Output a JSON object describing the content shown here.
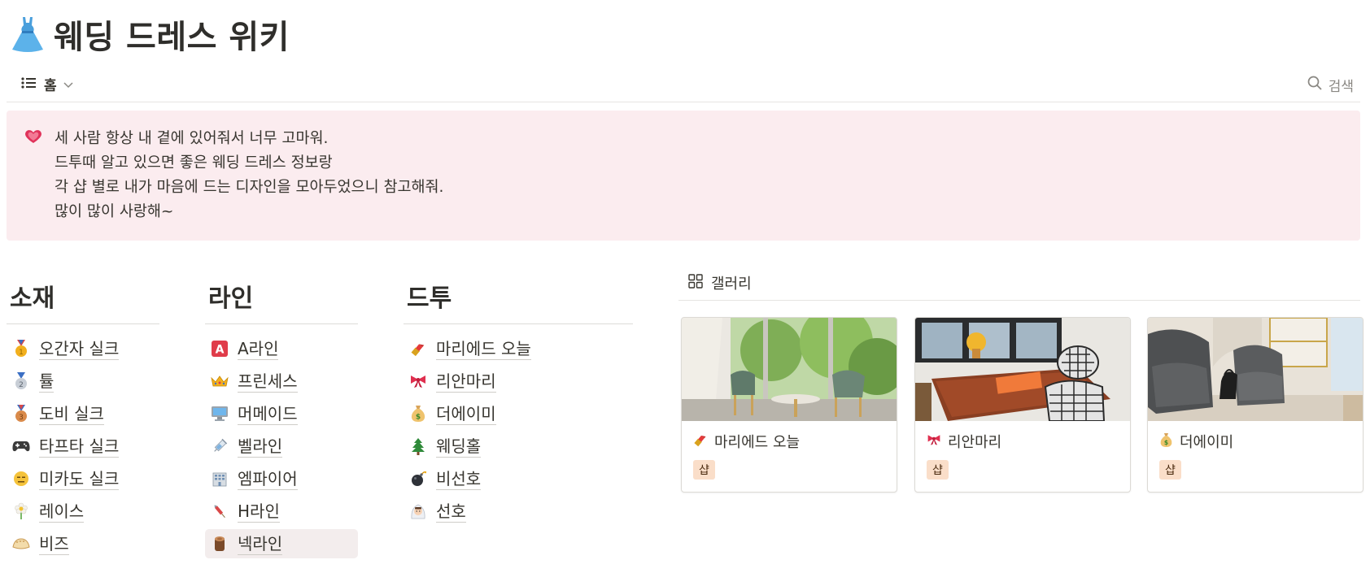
{
  "page": {
    "icon": "dress-icon",
    "title": "웨딩 드레스 위키"
  },
  "view_bar": {
    "tab_icon": "list-icon",
    "tab_label": "홈",
    "search_label": "검색"
  },
  "callout": {
    "icon": "heart-icon",
    "lines": [
      "세 사람 항상 내 곁에 있어줘서 너무 고마워.",
      "드투때 알고 있으면 좋은 웨딩 드레스 정보랑",
      "각 샵 별로 내가 마음에 드는 디자인을 모아두었으니 참고해줘.",
      "많이 많이 사랑해~"
    ]
  },
  "columns": [
    {
      "heading": "소재",
      "items": [
        {
          "icon": "gold-medal-icon",
          "label": "오간자 실크"
        },
        {
          "icon": "silver-medal-icon",
          "label": "튤"
        },
        {
          "icon": "bronze-medal-icon",
          "label": "도비 실크"
        },
        {
          "icon": "gamepad-icon",
          "label": "타프타 실크"
        },
        {
          "icon": "expressionless-face-icon",
          "label": "미카도 실크"
        },
        {
          "icon": "flower-icon",
          "label": "레이스"
        },
        {
          "icon": "dumpling-icon",
          "label": "비즈"
        }
      ]
    },
    {
      "heading": "라인",
      "items": [
        {
          "icon": "letter-a-icon",
          "label": "A라인"
        },
        {
          "icon": "crown-icon",
          "label": "프린세스"
        },
        {
          "icon": "computer-icon",
          "label": "머메이드"
        },
        {
          "icon": "syringe-icon",
          "label": "벨라인"
        },
        {
          "icon": "building-icon",
          "label": "엠파이어"
        },
        {
          "icon": "firework-rocket-icon",
          "label": "H라인"
        },
        {
          "icon": "log-icon",
          "label": "넥라인"
        }
      ]
    },
    {
      "heading": "드투",
      "items": [
        {
          "icon": "lipstick-icon",
          "label": "마리에드 오늘"
        },
        {
          "icon": "ribbon-icon",
          "label": "리안마리"
        },
        {
          "icon": "money-bag-icon",
          "label": "더에이미"
        },
        {
          "icon": "tree-icon",
          "label": "웨딩홀"
        },
        {
          "icon": "bomb-icon",
          "label": "비선호"
        },
        {
          "icon": "bride-icon",
          "label": "선호"
        }
      ]
    }
  ],
  "gallery": {
    "tab_icon": "gallery-grid-icon",
    "tab_label": "갤러리",
    "cards": [
      {
        "photo": "shop-window-chairs-photo",
        "icon": "lipstick-icon",
        "title": "마리에드 오늘",
        "tag": "샵"
      },
      {
        "photo": "table-and-chairs-photo",
        "icon": "ribbon-icon",
        "title": "리안마리",
        "tag": "샵"
      },
      {
        "photo": "armchairs-room-photo",
        "icon": "money-bag-icon",
        "title": "더에이미",
        "tag": "샵"
      }
    ]
  },
  "colors": {
    "callout_bg": "#fbecef",
    "tag_bg": "#fadec9",
    "text": "#37352f"
  }
}
